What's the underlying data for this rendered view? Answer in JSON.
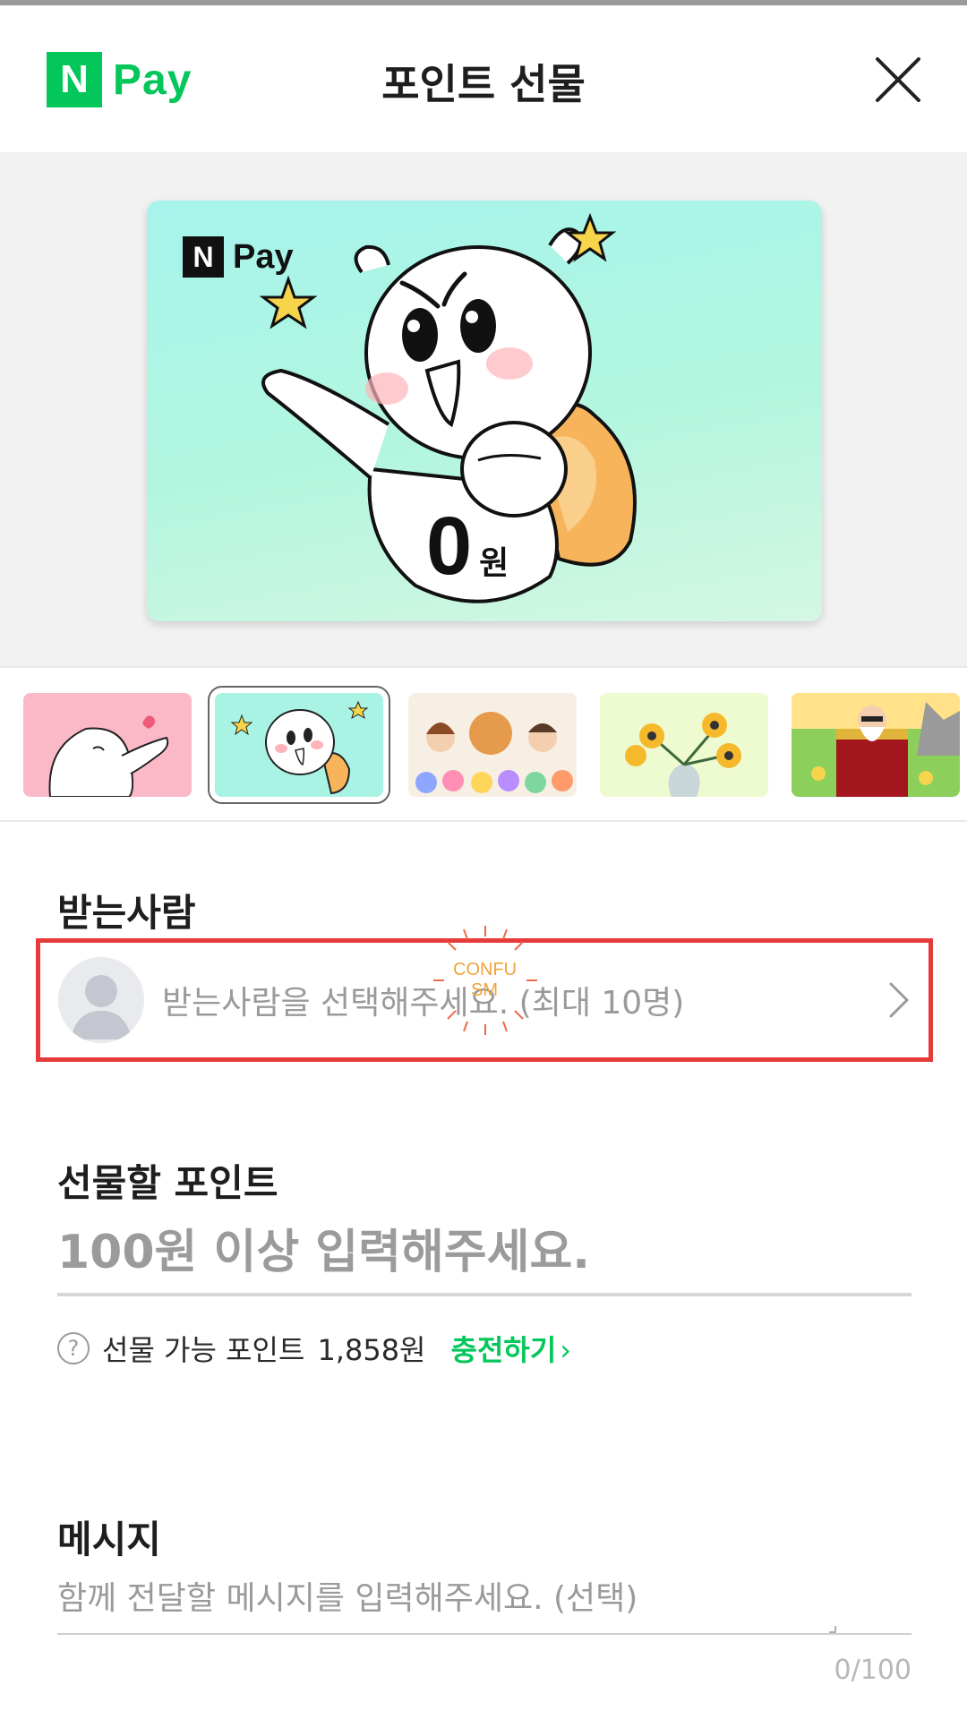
{
  "header": {
    "logo_n": "N",
    "logo_pay": "Pay",
    "title": "포인트 선물",
    "close_icon": "close-icon"
  },
  "card": {
    "logo_n": "N",
    "logo_pay": "Pay",
    "amount": "0",
    "unit": "원",
    "character": "white-bear-with-backpack"
  },
  "thumbnails": [
    {
      "name": "bear-kiss-pink",
      "selected": false
    },
    {
      "name": "bear-backpack-mint",
      "selected": true
    },
    {
      "name": "friends-flowers",
      "selected": false
    },
    {
      "name": "yellow-flowers-vase",
      "selected": false
    },
    {
      "name": "treasure-chest-old-man",
      "selected": false
    }
  ],
  "recipient": {
    "title": "받는사람",
    "placeholder": "받는사람을 선택해주세요. (최대 10명)",
    "avatar_icon": "person-avatar-icon",
    "chevron_icon": "chevron-right-icon"
  },
  "watermark": {
    "line1": "CONFU",
    "line2": "SM"
  },
  "points": {
    "title": "선물할 포인트",
    "placeholder": "100원 이상 입력해주세요.",
    "available_label": "선물 가능 포인트",
    "available_value": "1,858원",
    "charge_label": "충전하기",
    "charge_chevron": "›"
  },
  "message": {
    "title": "메시지",
    "placeholder": "함께 전달할 메시지를 입력해주세요. (선택)",
    "counter": "0/100"
  },
  "colors": {
    "brand_green": "#03c75a",
    "highlight_red": "#e63b3b",
    "placeholder_gray": "#9a9a9a"
  }
}
